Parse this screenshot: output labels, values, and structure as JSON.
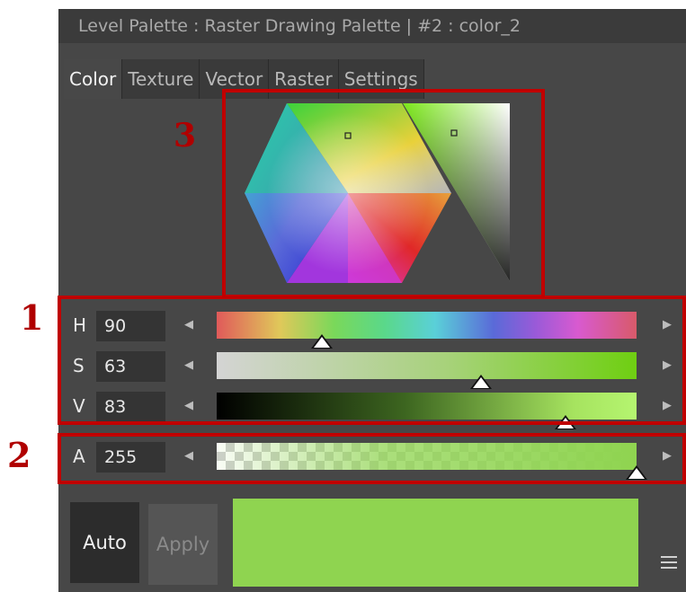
{
  "title": "Level Palette : Raster Drawing Palette | #2 : color_2",
  "tabs": [
    {
      "label": "Color",
      "active": true
    },
    {
      "label": "Texture",
      "active": false
    },
    {
      "label": "Vector",
      "active": false
    },
    {
      "label": "Raster",
      "active": false
    },
    {
      "label": "Settings",
      "active": false
    }
  ],
  "callouts": {
    "one": "1",
    "two": "2",
    "three": "3"
  },
  "channels": {
    "h": {
      "label": "H",
      "value": "90",
      "fraction": 0.25
    },
    "s": {
      "label": "S",
      "value": "63",
      "fraction": 0.63
    },
    "v": {
      "label": "V",
      "value": "83",
      "fraction": 0.83
    },
    "a": {
      "label": "A",
      "value": "255",
      "fraction": 1.0
    }
  },
  "arrows": {
    "left": "◀",
    "right": "▶"
  },
  "buttons": {
    "auto": "Auto",
    "apply": "Apply"
  },
  "current_color": "#8fd450",
  "accent_red": "#c00000",
  "icons": [
    "menu-icon",
    "arrow-left-icon",
    "arrow-right-icon"
  ]
}
